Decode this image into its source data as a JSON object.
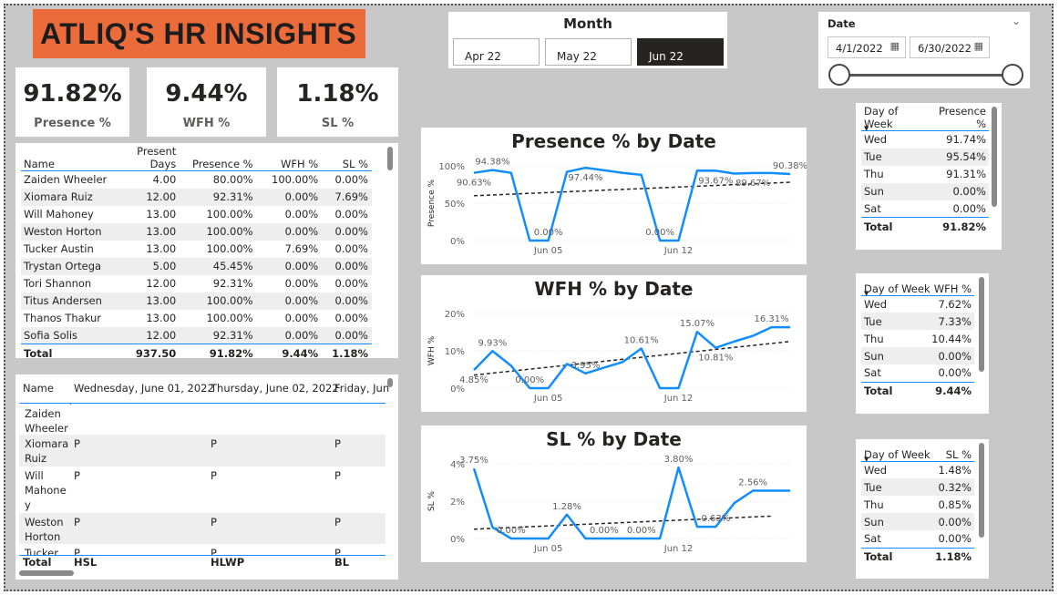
{
  "header": {
    "title": "ATLIQ'S HR INSIGHTS"
  },
  "kpis": [
    {
      "value": "91.82%",
      "label": "Presence %"
    },
    {
      "value": "9.44%",
      "label": "WFH %"
    },
    {
      "value": "1.18%",
      "label": "SL %"
    }
  ],
  "month_slicer": {
    "title": "Month",
    "options": [
      "Apr 22",
      "May 22",
      "Jun 22"
    ],
    "selected": "Jun 22"
  },
  "date_slicer": {
    "title": "Date",
    "start": "4/1/2022",
    "end": "6/30/2022",
    "chevron": "chevron-down-icon",
    "calendar_icon": "calendar-icon"
  },
  "employee_table": {
    "columns": [
      "Name",
      "Present Days",
      "Presence %",
      "WFH %",
      "SL %"
    ],
    "rows": [
      [
        "Zaiden Wheeler",
        "4.00",
        "80.00%",
        "100.00%",
        "0.00%"
      ],
      [
        "Xiomara Ruiz",
        "12.00",
        "92.31%",
        "0.00%",
        "7.69%"
      ],
      [
        "Will Mahoney",
        "13.00",
        "100.00%",
        "0.00%",
        "0.00%"
      ],
      [
        "Weston Horton",
        "13.00",
        "100.00%",
        "0.00%",
        "0.00%"
      ],
      [
        "Tucker Austin",
        "13.00",
        "100.00%",
        "7.69%",
        "0.00%"
      ],
      [
        "Trystan Ortega",
        "5.00",
        "45.45%",
        "0.00%",
        "0.00%"
      ],
      [
        "Tori Shannon",
        "12.00",
        "92.31%",
        "0.00%",
        "0.00%"
      ],
      [
        "Titus Andersen",
        "13.00",
        "100.00%",
        "0.00%",
        "0.00%"
      ],
      [
        "Thanos Thakur",
        "13.00",
        "100.00%",
        "0.00%",
        "0.00%"
      ],
      [
        "Sofia Solis",
        "12.00",
        "92.31%",
        "0.00%",
        "0.00%"
      ]
    ],
    "total": [
      "Total",
      "937.50",
      "91.82%",
      "9.44%",
      "1.18%"
    ]
  },
  "matrix_table": {
    "columns": [
      "Name",
      "Wednesday, June 01, 2022",
      "Thursday, June 02, 2022",
      "Friday, Jun"
    ],
    "rows": [
      {
        "name_lines": [
          "Zaiden",
          "Wheeler"
        ],
        "cells": [
          "",
          "",
          ""
        ]
      },
      {
        "name_lines": [
          "Xiomara",
          "Ruiz"
        ],
        "cells": [
          "P",
          "P",
          "P"
        ]
      },
      {
        "name_lines": [
          "Will",
          "Mahone",
          "y"
        ],
        "cells": [
          "P",
          "P",
          "P"
        ]
      },
      {
        "name_lines": [
          "Weston",
          "Horton"
        ],
        "cells": [
          "P",
          "P",
          "P"
        ]
      },
      {
        "name_lines": [
          "Tucker"
        ],
        "cells": [
          "P",
          "P",
          "P"
        ]
      }
    ],
    "total": [
      "Total",
      "HSL",
      "HLWP",
      "BL"
    ]
  },
  "dow_tables": [
    {
      "columns": [
        "Day of Week",
        "Presence %"
      ],
      "rows": [
        [
          "Wed",
          "91.74%"
        ],
        [
          "Tue",
          "95.54%"
        ],
        [
          "Thu",
          "91.31%"
        ],
        [
          "Sun",
          "0.00%"
        ],
        [
          "Sat",
          "0.00%"
        ]
      ],
      "total": [
        "Total",
        "91.82%"
      ]
    },
    {
      "columns": [
        "Day of Week",
        "WFH %"
      ],
      "rows": [
        [
          "Wed",
          "7.62%"
        ],
        [
          "Tue",
          "7.33%"
        ],
        [
          "Thu",
          "10.44%"
        ],
        [
          "Sun",
          "0.00%"
        ],
        [
          "Sat",
          "0.00%"
        ]
      ],
      "total": [
        "Total",
        "9.44%"
      ]
    },
    {
      "columns": [
        "Day of Week",
        "SL %"
      ],
      "rows": [
        [
          "Wed",
          "1.48%"
        ],
        [
          "Tue",
          "0.32%"
        ],
        [
          "Thu",
          "0.85%"
        ],
        [
          "Sun",
          "0.00%"
        ],
        [
          "Sat",
          "0.00%"
        ]
      ],
      "total": [
        "Total",
        "1.18%"
      ]
    }
  ],
  "colors": {
    "accent": "#118dff",
    "title_bg": "#eb6b3b",
    "canvas": "#c8c8c8",
    "selected": "#252423"
  },
  "chart_data": [
    {
      "type": "line",
      "title": "Presence % by Date",
      "ylabel": "Presence %",
      "xlabel": "",
      "x_ticks": [
        "Jun 05",
        "Jun 12"
      ],
      "y_ticks": [
        "100%",
        "50%",
        "0%"
      ],
      "ylim": [
        0,
        100
      ],
      "x": [
        1,
        2,
        3,
        4,
        5,
        6,
        7,
        8,
        9,
        10,
        11,
        12,
        13,
        14,
        15,
        16,
        17,
        18
      ],
      "y": [
        90.63,
        94.38,
        90.63,
        0,
        0,
        92,
        97.44,
        94,
        90.5,
        88,
        0,
        0,
        93.67,
        93.5,
        89.67,
        90.38,
        90.38,
        89
      ],
      "trend": [
        [
          1,
          60
        ],
        [
          18,
          78
        ]
      ],
      "labels": [
        {
          "i": 0,
          "text": "90.63%",
          "pos": "below"
        },
        {
          "i": 1,
          "text": "94.38%",
          "pos": "above"
        },
        {
          "i": 4,
          "text": "0.00%",
          "pos": "above"
        },
        {
          "i": 6,
          "text": "97.44%",
          "pos": "below"
        },
        {
          "i": 10,
          "text": "0.00%",
          "pos": "above"
        },
        {
          "i": 13,
          "text": "93.67%",
          "pos": "below"
        },
        {
          "i": 15,
          "text": "89.67%",
          "pos": "below"
        },
        {
          "i": 17,
          "text": "90.38%",
          "pos": "above"
        }
      ],
      "series": [
        {
          "name": "",
          "color": "#118dff"
        }
      ]
    },
    {
      "type": "line",
      "title": "WFH % by Date",
      "ylabel": "WFH %",
      "xlabel": "",
      "x_ticks": [
        "Jun 05",
        "Jun 12"
      ],
      "y_ticks": [
        "20%",
        "10%",
        "0%"
      ],
      "ylim": [
        0,
        20
      ],
      "x": [
        1,
        2,
        3,
        4,
        5,
        6,
        7,
        8,
        9,
        10,
        11,
        12,
        13,
        14,
        15,
        16,
        17,
        18
      ],
      "y": [
        4.85,
        9.93,
        6.0,
        0.0,
        0,
        6.5,
        3.95,
        5.5,
        7.0,
        10.61,
        0,
        0,
        15.07,
        10.81,
        12.5,
        14.0,
        16.31,
        16.31
      ],
      "trend": [
        [
          1,
          3.5
        ],
        [
          18,
          12.5
        ]
      ],
      "labels": [
        {
          "i": 0,
          "text": "4.85%",
          "pos": "below"
        },
        {
          "i": 1,
          "text": "9.93%",
          "pos": "above"
        },
        {
          "i": 3,
          "text": "0.00%",
          "pos": "above"
        },
        {
          "i": 6,
          "text": "3.95%",
          "pos": "above"
        },
        {
          "i": 9,
          "text": "10.61%",
          "pos": "above"
        },
        {
          "i": 12,
          "text": "15.07%",
          "pos": "above"
        },
        {
          "i": 13,
          "text": "10.81%",
          "pos": "below"
        },
        {
          "i": 16,
          "text": "16.31%",
          "pos": "above"
        }
      ],
      "series": [
        {
          "name": "",
          "color": "#118dff"
        }
      ]
    },
    {
      "type": "line",
      "title": "SL % by Date",
      "ylabel": "SL %",
      "xlabel": "",
      "x_ticks": [
        "Jun 05",
        "Jun 12"
      ],
      "y_ticks": [
        "4%",
        "2%",
        "0%"
      ],
      "ylim": [
        0,
        4
      ],
      "x": [
        1,
        2,
        3,
        4,
        5,
        6,
        7,
        8,
        9,
        10,
        11,
        12,
        13,
        14,
        15,
        16,
        17,
        18
      ],
      "y": [
        3.75,
        0.6,
        0.0,
        0.0,
        0.0,
        1.28,
        0.0,
        0.0,
        0.0,
        0.0,
        0.0,
        3.8,
        0.63,
        0.63,
        1.9,
        2.56,
        2.56,
        2.56
      ],
      "trend": [
        [
          1,
          0.5
        ],
        [
          17,
          1.2
        ]
      ],
      "labels": [
        {
          "i": 0,
          "text": "3.75%",
          "pos": "above"
        },
        {
          "i": 2,
          "text": "0.00%",
          "pos": "above"
        },
        {
          "i": 5,
          "text": "1.28%",
          "pos": "above"
        },
        {
          "i": 7,
          "text": "0.00%",
          "pos": "above"
        },
        {
          "i": 9,
          "text": "0.00%",
          "pos": "above"
        },
        {
          "i": 11,
          "text": "3.80%",
          "pos": "above"
        },
        {
          "i": 13,
          "text": "0.63%",
          "pos": "above"
        },
        {
          "i": 15,
          "text": "2.56%",
          "pos": "above"
        }
      ],
      "series": [
        {
          "name": "",
          "color": "#118dff"
        }
      ]
    }
  ]
}
